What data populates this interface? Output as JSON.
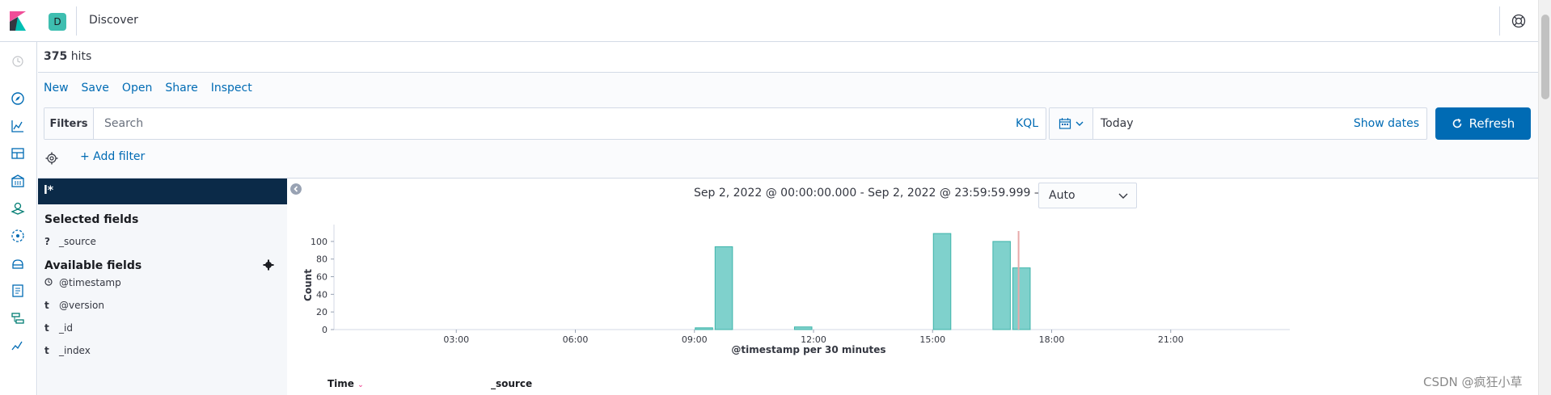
{
  "header": {
    "space_initial": "D",
    "app_title": "Discover"
  },
  "hits": {
    "count": "375",
    "label": "hits"
  },
  "top_nav": [
    "New",
    "Save",
    "Open",
    "Share",
    "Inspect"
  ],
  "query": {
    "filters_label": "Filters",
    "search_placeholder": "Search",
    "language": "KQL"
  },
  "date_picker": {
    "value": "Today",
    "show_dates": "Show dates"
  },
  "refresh_label": "Refresh",
  "add_filter_label": "+ Add filter",
  "sidebar": {
    "index_pattern": "l*",
    "selected_heading": "Selected fields",
    "selected_fields": [
      {
        "type": "?",
        "name": "_source"
      }
    ],
    "available_heading": "Available fields",
    "available_fields": [
      {
        "type": "clock",
        "name": "@timestamp"
      },
      {
        "type": "t",
        "name": "@version"
      },
      {
        "type": "t",
        "name": "_id"
      },
      {
        "type": "t",
        "name": "_index"
      }
    ]
  },
  "chart_header": {
    "range": "Sep 2, 2022 @ 00:00:00.000 - Sep 2, 2022 @ 23:59:59.999 —",
    "interval": "Auto"
  },
  "chart_data": {
    "type": "bar",
    "xlabel": "@timestamp per 30 minutes",
    "ylabel": "Count",
    "ylim": [
      0,
      110
    ],
    "yticks": [
      0,
      20,
      40,
      60,
      80,
      100
    ],
    "xticks": [
      "03:00",
      "06:00",
      "09:00",
      "12:00",
      "15:00",
      "18:00",
      "21:00"
    ],
    "bins": [
      {
        "start": "09:00",
        "value": 2
      },
      {
        "start": "09:30",
        "value": 94
      },
      {
        "start": "11:30",
        "value": 3
      },
      {
        "start": "15:00",
        "value": 109
      },
      {
        "start": "16:30",
        "value": 100
      },
      {
        "start": "17:00",
        "value": 70
      }
    ],
    "now_marker": "17:10",
    "colors": {
      "bar": "#7fd1cc",
      "bar_stroke": "#3eb4aa",
      "marker": "#e7a9a9"
    }
  },
  "table": {
    "columns": [
      "Time",
      "_source"
    ]
  },
  "watermark": "CSDN @疯狂小草"
}
